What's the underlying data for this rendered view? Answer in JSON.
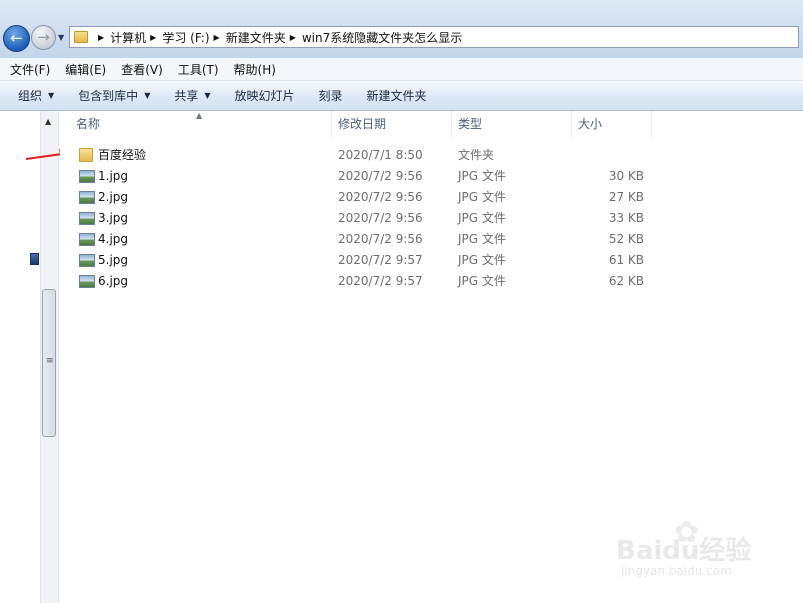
{
  "address": {
    "crumbs": [
      "计算机",
      "学习 (F:)",
      "新建文件夹",
      "win7系统隐藏文件夹怎么显示"
    ]
  },
  "menu": [
    "文件(F)",
    "编辑(E)",
    "查看(V)",
    "工具(T)",
    "帮助(H)"
  ],
  "commands": [
    {
      "label": "组织",
      "dropdown": true
    },
    {
      "label": "包含到库中",
      "dropdown": true
    },
    {
      "label": "共享",
      "dropdown": true
    },
    {
      "label": "放映幻灯片",
      "dropdown": false
    },
    {
      "label": "刻录",
      "dropdown": false
    },
    {
      "label": "新建文件夹",
      "dropdown": false
    }
  ],
  "columns": {
    "name": "名称",
    "date": "修改日期",
    "type": "类型",
    "size": "大小"
  },
  "files": [
    {
      "name": "百度经验",
      "date": "2020/7/1 8:50",
      "type": "文件夹",
      "size": "",
      "icon": "folder-icon"
    },
    {
      "name": "1.jpg",
      "date": "2020/7/2 9:56",
      "type": "JPG 文件",
      "size": "30 KB",
      "icon": "jpg-icon"
    },
    {
      "name": "2.jpg",
      "date": "2020/7/2 9:56",
      "type": "JPG 文件",
      "size": "27 KB",
      "icon": "jpg-icon"
    },
    {
      "name": "3.jpg",
      "date": "2020/7/2 9:56",
      "type": "JPG 文件",
      "size": "33 KB",
      "icon": "jpg-icon"
    },
    {
      "name": "4.jpg",
      "date": "2020/7/2 9:56",
      "type": "JPG 文件",
      "size": "52 KB",
      "icon": "jpg-icon"
    },
    {
      "name": "5.jpg",
      "date": "2020/7/2 9:57",
      "type": "JPG 文件",
      "size": "61 KB",
      "icon": "jpg-icon"
    },
    {
      "name": "6.jpg",
      "date": "2020/7/2 9:57",
      "type": "JPG 文件",
      "size": "62 KB",
      "icon": "jpg-icon"
    }
  ],
  "watermark": {
    "text": "Baidu经验",
    "sub": "jingyan.baidu.com"
  },
  "colors": {
    "accent": "#1f5fb8",
    "arrow": "#e02020"
  }
}
